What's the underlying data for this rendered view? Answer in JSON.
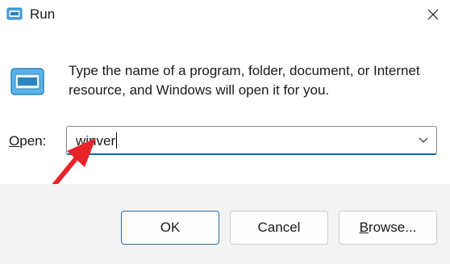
{
  "window": {
    "title": "Run",
    "icon": "run-icon",
    "close_icon": "close-icon"
  },
  "dialog": {
    "description": "Type the name of a program, folder, document, or Internet resource, and Windows will open it for you.",
    "open_label_mnemonic": "O",
    "open_label_rest": "pen:",
    "input_value": "winver"
  },
  "buttons": {
    "ok": "OK",
    "cancel": "Cancel",
    "browse_mnemonic": "B",
    "browse_rest": "rowse..."
  },
  "colors": {
    "accent": "#0067c0",
    "annotation_arrow": "#e8242a",
    "footer_bg": "#f3f3f3"
  }
}
